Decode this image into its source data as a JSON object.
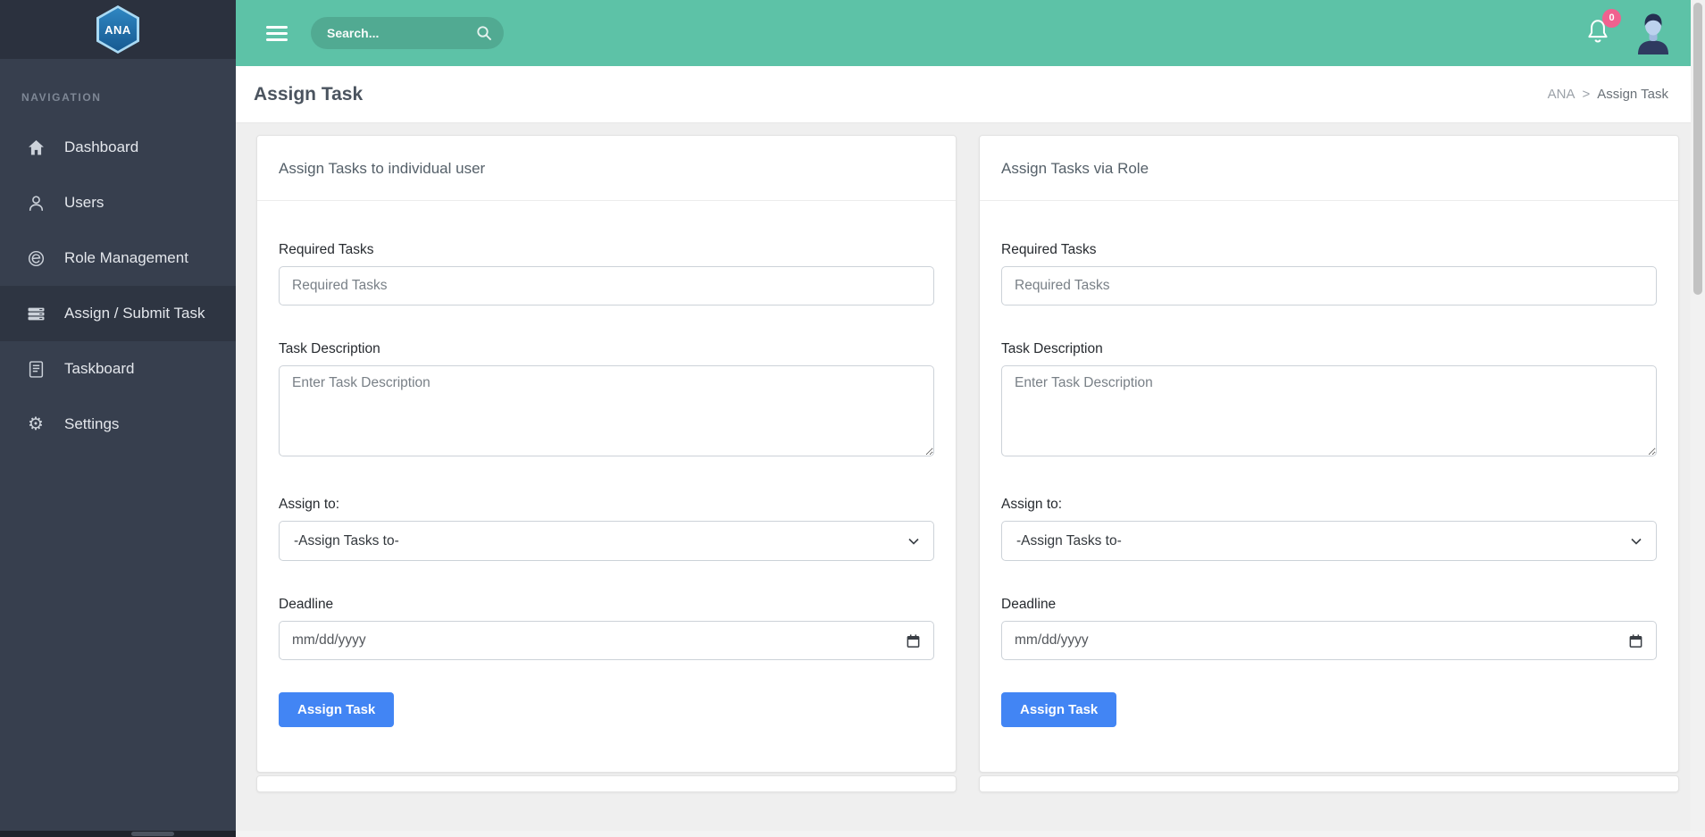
{
  "brand": {
    "logo_text": "ANA"
  },
  "sidebar": {
    "section_label": "NAVIGATION",
    "items": [
      {
        "label": "Dashboard",
        "icon": "home-icon",
        "active": false
      },
      {
        "label": "Users",
        "icon": "user-icon",
        "active": false
      },
      {
        "label": "Role Management",
        "icon": "role-icon",
        "active": false
      },
      {
        "label": "Assign / Submit Task",
        "icon": "tasks-icon",
        "active": true
      },
      {
        "label": "Taskboard",
        "icon": "document-icon",
        "active": false
      },
      {
        "label": "Settings",
        "icon": "gear-icon",
        "active": false
      }
    ]
  },
  "topbar": {
    "search_placeholder": "Search...",
    "notification_badge": "0"
  },
  "page_header": {
    "title": "Assign Task",
    "breadcrumb_root": "ANA",
    "breadcrumb_separator": ">",
    "breadcrumb_current": "Assign Task"
  },
  "cards": [
    {
      "title": "Assign Tasks to individual user",
      "required_tasks": {
        "label": "Required Tasks",
        "placeholder": "Required Tasks"
      },
      "task_description": {
        "label": "Task Description",
        "placeholder": "Enter Task Description"
      },
      "assign_to": {
        "label": "Assign to:",
        "selected_option": "-Assign Tasks to-"
      },
      "deadline": {
        "label": "Deadline",
        "placeholder": "mm/dd/yyyy"
      },
      "submit_label": "Assign Task"
    },
    {
      "title": "Assign Tasks via Role",
      "required_tasks": {
        "label": "Required Tasks",
        "placeholder": "Required Tasks"
      },
      "task_description": {
        "label": "Task Description",
        "placeholder": "Enter Task Description"
      },
      "assign_to": {
        "label": "Assign to:",
        "selected_option": "-Assign Tasks to-"
      },
      "deadline": {
        "label": "Deadline",
        "placeholder": "mm/dd/yyyy"
      },
      "submit_label": "Assign Task"
    }
  ],
  "colors": {
    "topbar_teal": "#5dc2a7",
    "sidebar_dark": "#373f4e",
    "sidebar_header_dark": "#2b313e",
    "active_nav_dark": "#2e3542",
    "primary_button_blue": "#4285f4",
    "badge_pink": "#f0618f",
    "page_background": "#efefef"
  }
}
